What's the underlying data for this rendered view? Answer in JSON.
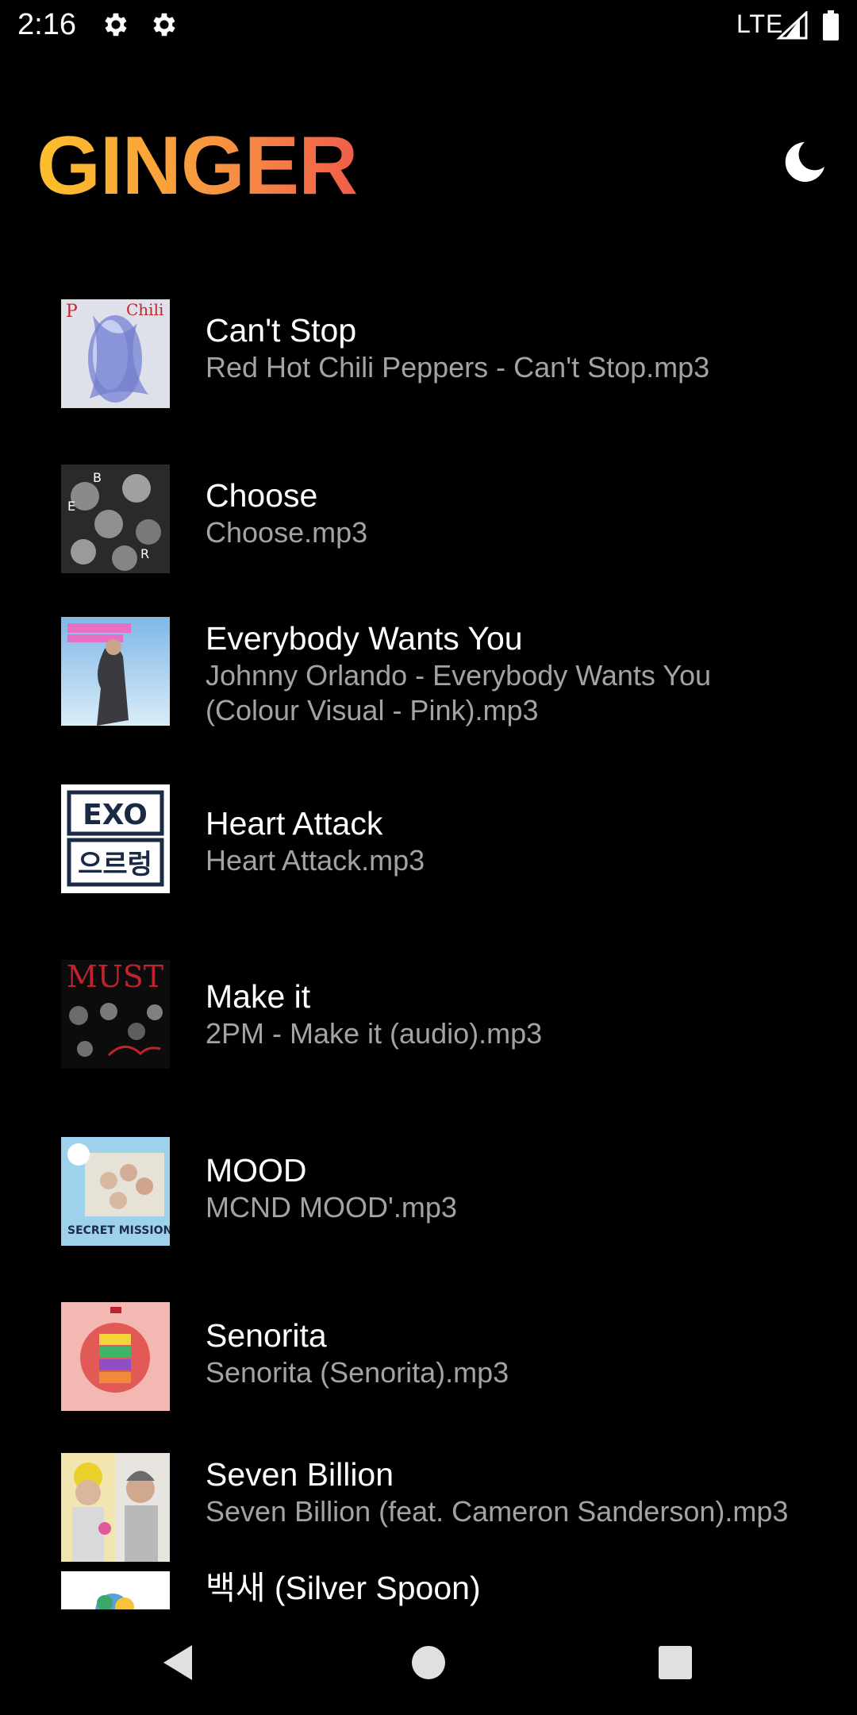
{
  "status_bar": {
    "time": "2:16",
    "network": "LTE",
    "icons": [
      "gear-icon",
      "gear-icon",
      "signal-icon",
      "battery-icon"
    ]
  },
  "app": {
    "title": "GINGER",
    "title_gradient": [
      "#fcc02b",
      "#f89640",
      "#f15d4a"
    ],
    "theme_icon": "moon-icon"
  },
  "songs": [
    {
      "title": "Can't Stop",
      "file": "Red Hot Chili Peppers - Can't Stop.mp3",
      "art": "album-art-cant-stop"
    },
    {
      "title": "Choose",
      "file": "Choose.mp3",
      "art": "album-art-choose"
    },
    {
      "title": "Everybody Wants You",
      "file": "Johnny Orlando - Everybody Wants You (Colour Visual - Pink).mp3",
      "art": "album-art-everybody-wants-you"
    },
    {
      "title": "Heart Attack",
      "file": "Heart Attack.mp3",
      "art": "album-art-heart-attack"
    },
    {
      "title": "Make it",
      "file": "2PM - Make it (audio).mp3",
      "art": "album-art-make-it"
    },
    {
      "title": "MOOD",
      "file": "MCND MOOD'.mp3",
      "art": "album-art-mood"
    },
    {
      "title": "Senorita",
      "file": "Senorita (Senorita).mp3",
      "art": "album-art-senorita"
    },
    {
      "title": "Seven Billion",
      "file": "Seven Billion (feat. Cameron Sanderson).mp3",
      "art": "album-art-seven-billion"
    },
    {
      "title": "백새 (Silver Spoon)",
      "file": "",
      "art": "album-art-silver-spoon"
    }
  ],
  "art_text": {
    "heart_attack": "으르렁",
    "make_it": "MUST",
    "mood": "SECRET MISSION"
  },
  "nav_bar": {
    "icons": [
      "back-icon",
      "home-icon",
      "recents-icon"
    ]
  },
  "colors": {
    "background": "#000000",
    "title_text": "#ffffff",
    "subtitle_text": "#a3a3a3"
  }
}
